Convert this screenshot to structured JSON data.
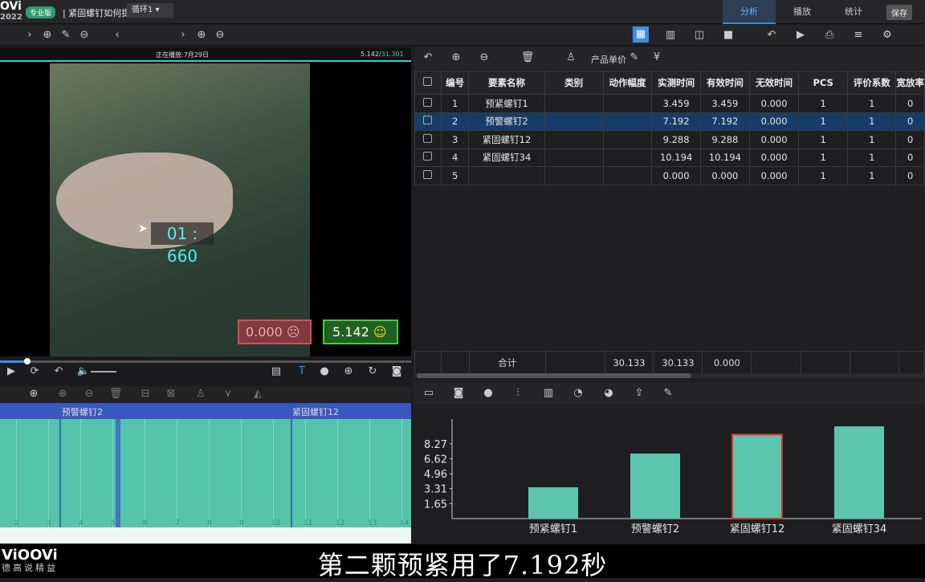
{
  "app": {
    "logo": "OVi",
    "year": "2022",
    "badge": "专业版",
    "title": "紧固螺钉如何提高效率"
  },
  "tabs": [
    {
      "label": "分析"
    },
    {
      "label": "播放"
    },
    {
      "label": "统计"
    }
  ],
  "save_label": "保存",
  "toolbar": {
    "loop_value": "循环1"
  },
  "video": {
    "now_playing": "正在播放:7月29日",
    "time_current": "5.142/",
    "time_total": "31.301",
    "timer": "01 : 660",
    "invalid_value": "0.000",
    "valid_value": "5.142",
    "progress": 0.066
  },
  "timeline": {
    "labels": [
      "预警螺钉2",
      "紧固螺钉12"
    ],
    "ticks": [
      "2",
      "3",
      "4",
      "5",
      "6",
      "7",
      "8",
      "9",
      "10",
      "11",
      "12",
      "13",
      "14"
    ]
  },
  "table": {
    "toolbar_label": "产品单价",
    "headers": [
      "编号",
      "要素名称",
      "类别",
      "动作幅度",
      "实测时间",
      "有效时间",
      "无效时间",
      "PCS",
      "评价系数",
      "宽放率"
    ],
    "rows": [
      [
        "1",
        "预紧螺钉1",
        "",
        "",
        "3.459",
        "3.459",
        "0.000",
        "1",
        "1",
        "0"
      ],
      [
        "2",
        "预警螺钉2",
        "",
        "",
        "7.192",
        "7.192",
        "0.000",
        "1",
        "1",
        "0"
      ],
      [
        "3",
        "紧固螺钉12",
        "",
        "",
        "9.288",
        "9.288",
        "0.000",
        "1",
        "1",
        "0"
      ],
      [
        "4",
        "紧固螺钉34",
        "",
        "",
        "10.194",
        "10.194",
        "0.000",
        "1",
        "1",
        "0"
      ],
      [
        "5",
        "",
        "",
        "",
        "0.000",
        "0.000",
        "0.000",
        "1",
        "1",
        "0"
      ]
    ],
    "selected_row": 1,
    "sum": {
      "label": "合计",
      "measured": "30.133",
      "effective": "30.133",
      "invalid": "0.000"
    }
  },
  "chart_data": {
    "type": "bar",
    "categories": [
      "预紧螺钉1",
      "预警螺钉2",
      "紧固螺钉12",
      "紧固螺钉34"
    ],
    "values": [
      3.459,
      7.192,
      9.288,
      10.194
    ],
    "yticks": [
      "1.65",
      "3.31",
      "4.96",
      "6.62",
      "8.27"
    ],
    "ylim": [
      0,
      11
    ],
    "highlighted": 2,
    "colors": {
      "bar": "#5bc6ad",
      "highlight": "#e03030"
    }
  },
  "subtitle": "第二颗预紧用了7.192秒",
  "watermark": {
    "brand": "ViOOVi",
    "slogan": "德高说精益"
  }
}
